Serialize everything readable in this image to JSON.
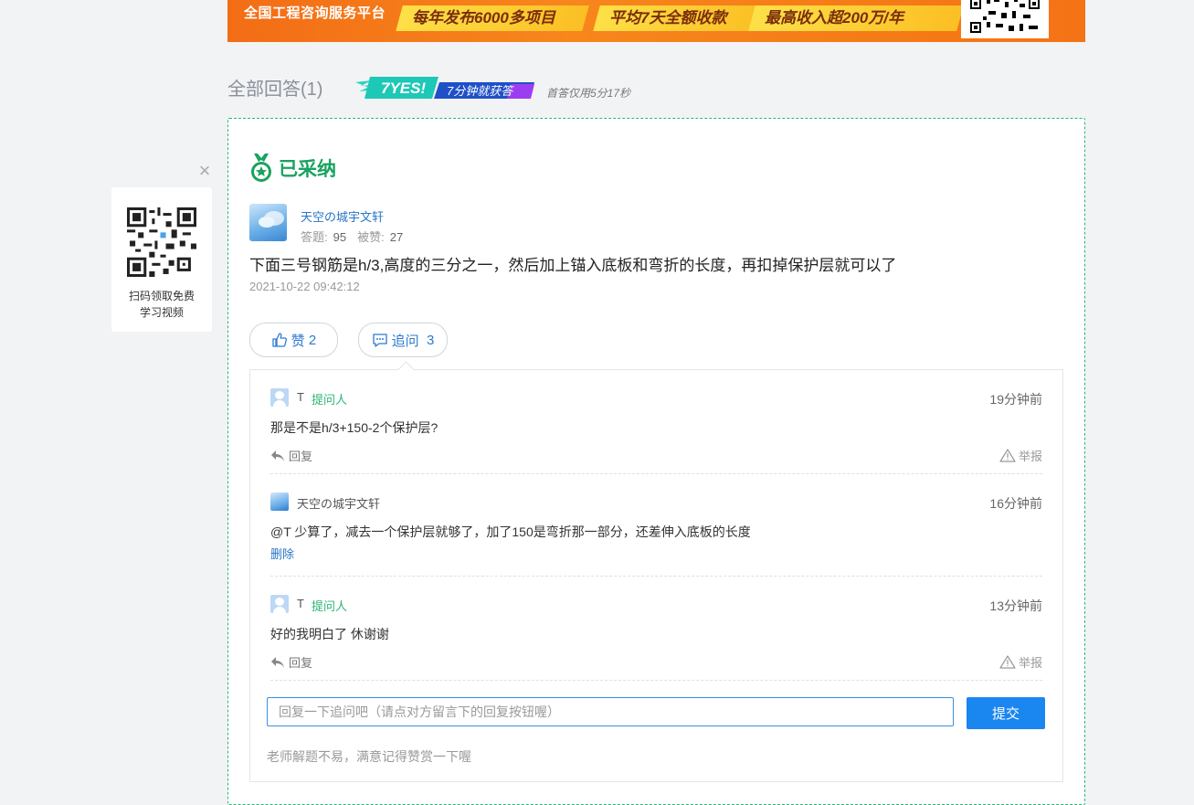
{
  "banner": {
    "title": "全国工程咨询服务平台",
    "pill1": "每年发布6000多项目",
    "pill2": "平均7天全额收款",
    "pill3": "最高收入超200万/年"
  },
  "answers": {
    "heading": "全部回答(1)",
    "badge_yes": "7YES!",
    "badge_text": "7分钟就获答",
    "first_answer_time": "首答仅用5分17秒"
  },
  "qr_float": {
    "caption": "扫码领取免费学习视频",
    "close": "×"
  },
  "answer": {
    "adopted_label": "已采纳",
    "user_name": "天空の城宇文轩",
    "answers_label": "答题:",
    "answers_count": "95",
    "liked_label": "被赞:",
    "liked_count": "27",
    "text": "下面三号钢筋是h/3,高度的三分之一，然后加上锚入底板和弯折的长度，再扣掉保护层就可以了",
    "time": "2021-10-22 09:42:12",
    "like_label": "赞",
    "like_count": "2",
    "ask_label": "追问",
    "ask_count": "3"
  },
  "comments": [
    {
      "name": "T",
      "role": "提问人",
      "time": "19分钟前",
      "text": "那是不是h/3+150-2个保护层?",
      "reply": "回复",
      "report": "举报"
    },
    {
      "name": "天空の城宇文轩",
      "time": "16分钟前",
      "text": "@T  少算了，减去一个保护层就够了，加了150是弯折那一部分，还差伸入底板的长度",
      "delete": "删除"
    },
    {
      "name": "T",
      "role": "提问人",
      "time": "13分钟前",
      "text": "好的我明白了 休谢谢",
      "reply": "回复",
      "report": "举报"
    }
  ],
  "reply_box": {
    "placeholder": "回复一下追问吧（请点对方留言下的回复按钮喔）",
    "submit": "提交",
    "tip": "老师解题不易，满意记得赞赏一下喔"
  },
  "colors": {
    "accent_green": "#1aa260",
    "link_blue": "#2776c7",
    "submit_blue": "#1a86f0",
    "banner_orange": "#f36d16"
  }
}
